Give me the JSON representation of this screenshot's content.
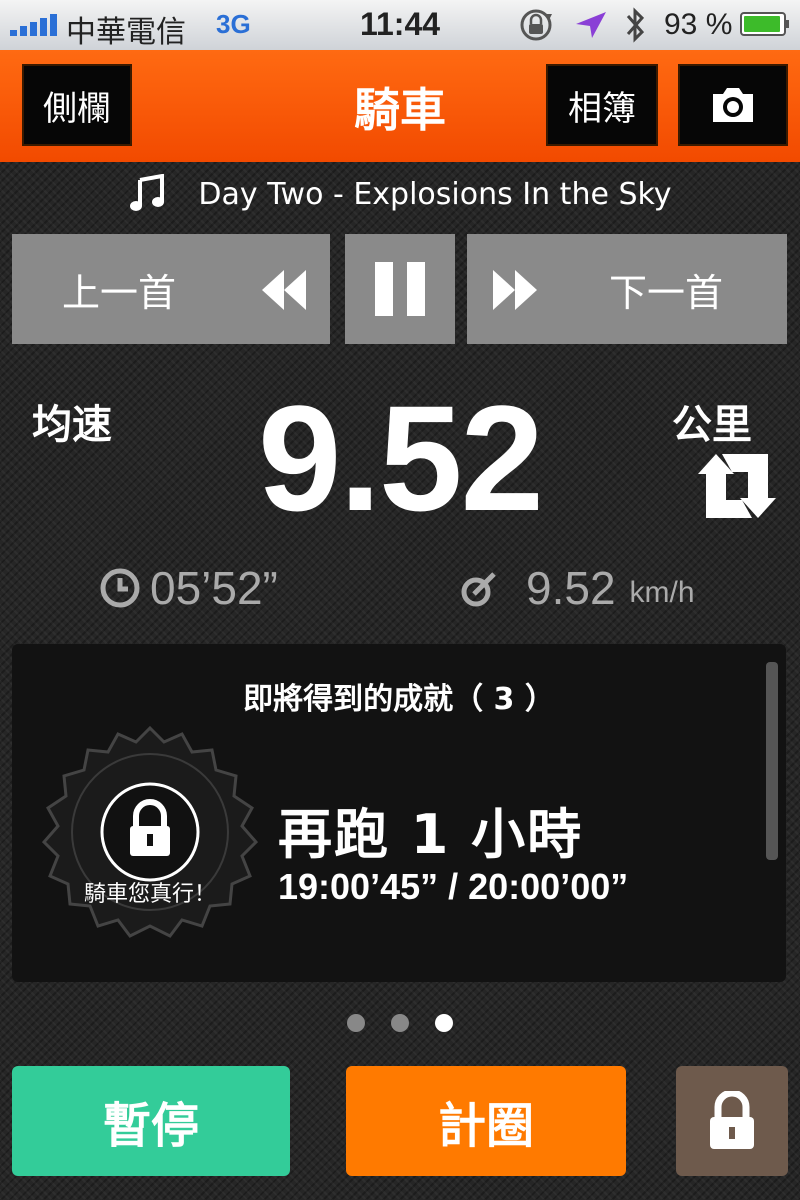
{
  "status_bar": {
    "carrier": "中華電信",
    "network": "3G",
    "time": "11:44",
    "battery_percent": "93 %",
    "icons": [
      "signal-icon",
      "rotation-lock-icon",
      "location-icon",
      "bluetooth-icon",
      "battery-icon"
    ]
  },
  "nav": {
    "sidebar_label": "側欄",
    "title": "騎車",
    "album_label": "相簿",
    "camera_icon": "camera-icon"
  },
  "music": {
    "now_playing": "Day Two - Explosions In the Sky",
    "prev_label": "上一首",
    "next_label": "下一首",
    "icons": [
      "music-note-icon",
      "rewind-icon",
      "pause-icon",
      "fast-forward-icon"
    ]
  },
  "metrics": {
    "left_label": "均速",
    "main_value": "9.52",
    "unit_label": "公里",
    "duration": "05’52”",
    "speed_value": "9.52",
    "speed_unit": "km/h",
    "icons": [
      "swap-units-icon",
      "clock-icon",
      "speedometer-icon"
    ]
  },
  "achievement": {
    "title": "即將得到的成就（ 3 ）",
    "badge_caption": "騎車您真行！",
    "main": "再跑 1 小時",
    "progress": "19:00’45” / 20:00’00”",
    "icons": [
      "achievement-seal-icon",
      "lock-icon"
    ]
  },
  "pager": {
    "count": 3,
    "active_index": 2
  },
  "buttons": {
    "pause_label": "暫停",
    "lap_label": "計圈",
    "lock_icon": "lock-icon"
  },
  "colors": {
    "nav_orange": "#f24a00",
    "pause_green": "#33cc99",
    "lap_orange": "#ff7a00",
    "lock_brown": "#6e5a4c",
    "network_blue": "#2a6fd6"
  }
}
